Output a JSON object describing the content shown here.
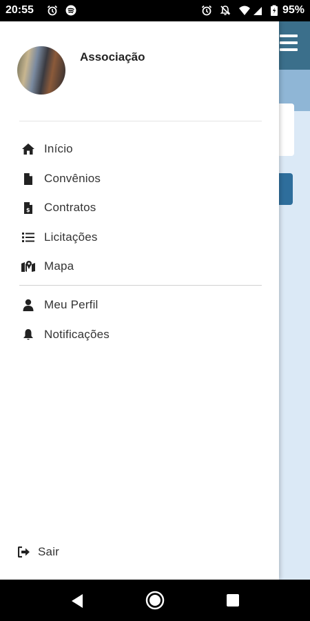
{
  "status_bar": {
    "time": "20:55",
    "battery_percent": "95%"
  },
  "drawer": {
    "profile": {
      "name": "Associação"
    },
    "menu": [
      {
        "label": "Início",
        "icon": "home-icon"
      },
      {
        "label": "Convênios",
        "icon": "document-icon"
      },
      {
        "label": "Contratos",
        "icon": "contract-icon"
      },
      {
        "label": "Licitações",
        "icon": "list-icon"
      },
      {
        "label": "Mapa",
        "icon": "map-icon"
      }
    ],
    "secondary_menu": [
      {
        "label": "Meu Perfil",
        "icon": "user-icon"
      },
      {
        "label": "Notificações",
        "icon": "bell-icon"
      }
    ],
    "logout": {
      "label": "Sair",
      "icon": "sign-out-icon"
    }
  },
  "colors": {
    "header": "#3b6f8b",
    "app_background": "#dbe9f6",
    "button": "#2e6e9c"
  }
}
